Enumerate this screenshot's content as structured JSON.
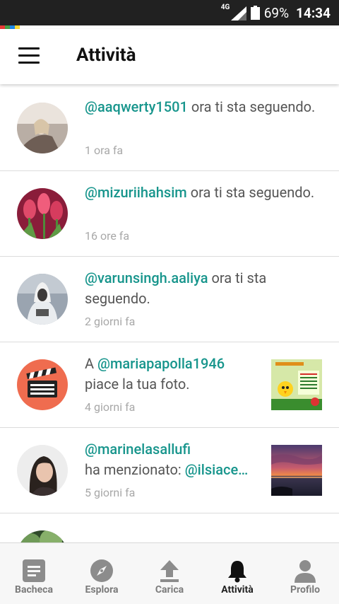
{
  "status_bar": {
    "network": "4G",
    "battery_percent": "69%",
    "time": "14:34"
  },
  "app_bar": {
    "title": "Attività",
    "menu_icon": "hamburger-menu-icon"
  },
  "brand_colors": [
    "#e53935",
    "#43a047",
    "#1e88e5",
    "#fdd835"
  ],
  "accent_color": "#17958c",
  "activities": [
    {
      "prefix": "",
      "handle": "@aaqwerty1501",
      "message": " ora ti sta seguendo.",
      "time": "1 ora fa"
    },
    {
      "prefix": "",
      "handle": "@mizuriihahsim",
      "message": " ora ti sta seguendo.",
      "time": "16 ore fa"
    },
    {
      "prefix": "",
      "handle": "@varunsingh.aaliya",
      "message": " ora ti sta seguendo.",
      "time": "2 giorni fa"
    },
    {
      "prefix": "A ",
      "handle": "@mariapapolla1946",
      "message": " piace la tua foto.",
      "time": "4 giorni fa"
    },
    {
      "prefix": "",
      "handle": "@marinelasallufi",
      "message": "ha menzionato: ",
      "mention": "@ilsiace…",
      "time": "5 giorni fa"
    }
  ],
  "bottom_nav": [
    {
      "label": "Bacheca",
      "icon": "board-icon"
    },
    {
      "label": "Esplora",
      "icon": "compass-icon"
    },
    {
      "label": "Carica",
      "icon": "upload-icon"
    },
    {
      "label": "Attività",
      "icon": "bell-icon",
      "active": true
    },
    {
      "label": "Profilo",
      "icon": "person-icon"
    }
  ]
}
